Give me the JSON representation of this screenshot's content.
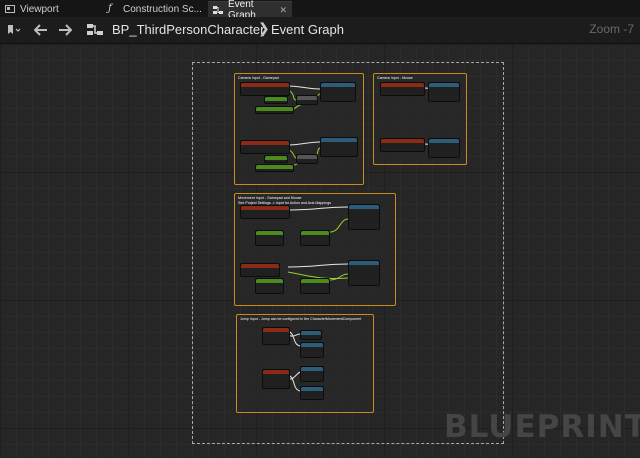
{
  "tabs": [
    {
      "label": "Viewport",
      "icon": "viewport-icon"
    },
    {
      "label": "Construction Sc...",
      "icon": "function-icon"
    },
    {
      "label": "Event Graph",
      "icon": "graph-icon",
      "active": true
    }
  ],
  "toolbar": {
    "breadcrumb_root": "BP_ThirdPersonCharacter",
    "breadcrumb_separator": "❯",
    "breadcrumb_current": "Event Graph",
    "zoom": "Zoom -7"
  },
  "comments": [
    {
      "title": "Camera Input - Gamepad"
    },
    {
      "title": "Camera Input - Mouse"
    },
    {
      "title": "Movement Input - Gamepad and Mouse\nSee Project Settings -> Input for Action and Axis Mappings"
    },
    {
      "title": "Jump Input - Jump can be configured in the CharacterMovementComponent"
    }
  ],
  "watermark": "BLUEPRINT",
  "colors": {
    "comment_border": "#c98b1d",
    "event_header": "#8c2a18",
    "function_header": "#2d5c7a",
    "pure_header": "#4b8a1c"
  }
}
